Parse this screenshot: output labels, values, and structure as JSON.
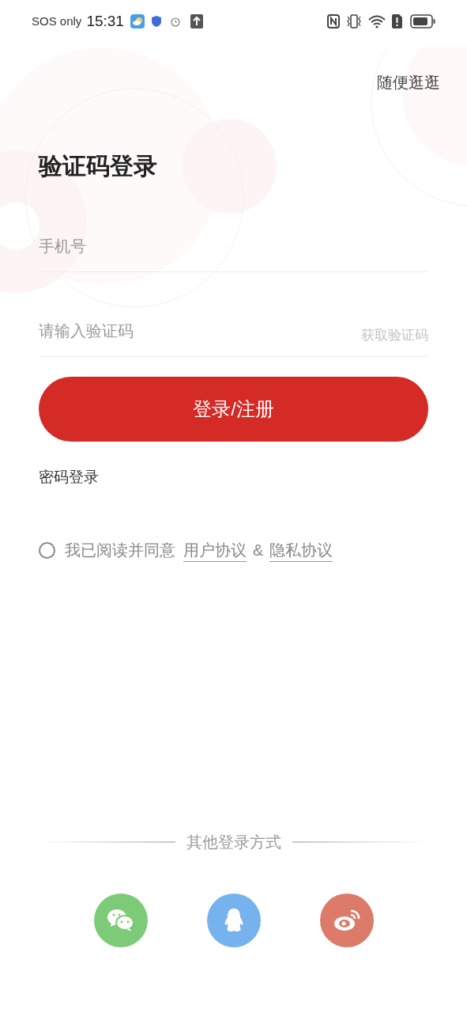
{
  "status_bar": {
    "carrier": "SOS only",
    "time": "15:31"
  },
  "skip_link": "随便逛逛",
  "title": "验证码登录",
  "fields": [
    {
      "placeholder": "手机号"
    },
    {
      "placeholder": "请输入验证码",
      "action": "获取验证码"
    }
  ],
  "submit_button": "登录/注册",
  "password_login_link": "密码登录",
  "agreement": {
    "checked": false,
    "text": "我已阅读并同意",
    "links": [
      "用户协议",
      "隐私协议"
    ],
    "separator": "&"
  },
  "other_logins": {
    "title": "其他登录方式",
    "providers": [
      {
        "kind": "wechat",
        "color": "#7dcb78"
      },
      {
        "kind": "qq",
        "color": "#76b2ee"
      },
      {
        "kind": "weibo",
        "color": "#dc7b69"
      }
    ]
  }
}
